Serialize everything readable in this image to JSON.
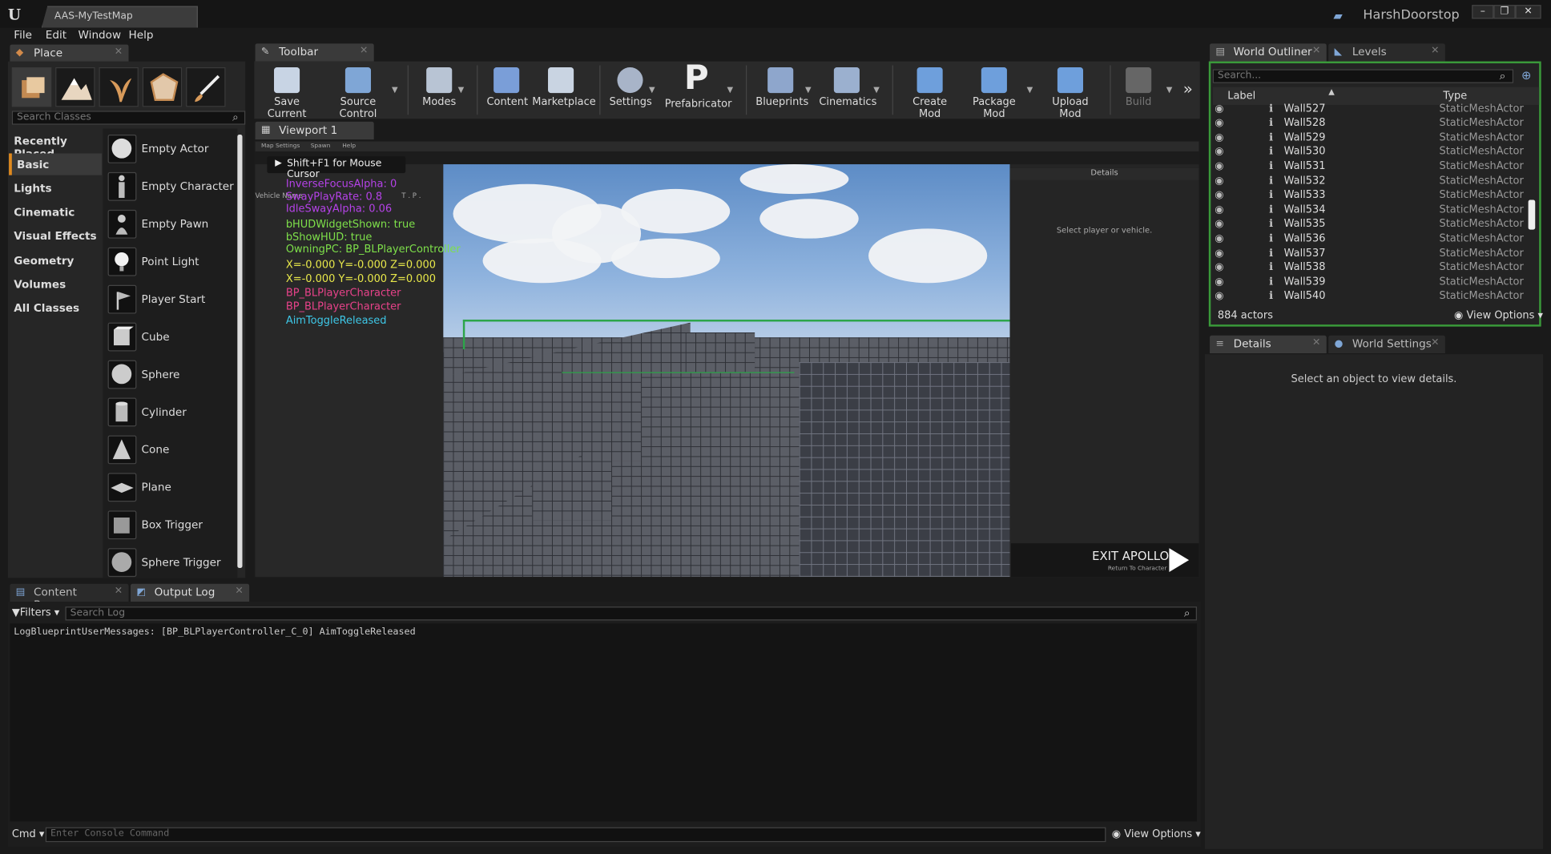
{
  "window": {
    "tab_title": "AAS-MyTestMap",
    "user": "HarshDoorstop"
  },
  "menu": [
    "File",
    "Edit",
    "Window",
    "Help"
  ],
  "place": {
    "tab": "Place",
    "search_placeholder": "Search Classes",
    "categories": [
      "Recently Placed",
      "Basic",
      "Lights",
      "Cinematic",
      "Visual Effects",
      "Geometry",
      "Volumes",
      "All Classes"
    ],
    "items": [
      "Empty Actor",
      "Empty Character",
      "Empty Pawn",
      "Point Light",
      "Player Start",
      "Cube",
      "Sphere",
      "Cylinder",
      "Cone",
      "Plane",
      "Box Trigger",
      "Sphere Trigger"
    ]
  },
  "toolbar": {
    "tab": "Toolbar",
    "buttons": [
      "Save Current",
      "Source Control",
      "Modes",
      "Content",
      "Marketplace",
      "Settings",
      "Prefabricator",
      "Blueprints",
      "Cinematics",
      "Create Mod",
      "Package Mod",
      "Upload Mod",
      "Build"
    ]
  },
  "viewport": {
    "tab": "Viewport 1",
    "menu": [
      "Map Settings",
      "Spawn",
      "Help"
    ],
    "mouse_hint": "Shift+F1 for Mouse Cursor",
    "vehicle_label": "Vehicle Name",
    "vehicle_cols": "T . P .",
    "details_title": "Details",
    "details_msg": "Select player or vehicle.",
    "exit_title": "EXIT APOLLO",
    "exit_sub": "Return To Character",
    "debug_lines": [
      {
        "text": "InverseFocusAlpha: 0",
        "color": "#b542e8"
      },
      {
        "text": "SwayPlayRate: 0.8",
        "color": "#b542e8"
      },
      {
        "text": "IdleSwayAlpha: 0.06",
        "color": "#b542e8"
      },
      {
        "text": "bHUDWidgetShown: true",
        "color": "#7ee04a"
      },
      {
        "text": "bShowHUD: true",
        "color": "#7ee04a"
      },
      {
        "text": "OwningPC: BP_BLPlayerController",
        "color": "#7ee04a"
      },
      {
        "text": "X=-0.000 Y=-0.000 Z=0.000",
        "color": "#e8e84a"
      },
      {
        "text": "X=-0.000 Y=-0.000 Z=0.000",
        "color": "#e8e84a"
      },
      {
        "text": "BP_BLPlayerCharacter",
        "color": "#e8428a"
      },
      {
        "text": "BP_BLPlayerCharacter",
        "color": "#e8428a"
      },
      {
        "text": "AimToggleReleased",
        "color": "#3ec8e8"
      }
    ]
  },
  "outliner": {
    "tab_outliner": "World Outliner",
    "tab_levels": "Levels",
    "search_placeholder": "Search...",
    "col_label": "Label",
    "col_type": "Type",
    "rows": [
      {
        "label": "Wall527",
        "type": "StaticMeshActor"
      },
      {
        "label": "Wall528",
        "type": "StaticMeshActor"
      },
      {
        "label": "Wall529",
        "type": "StaticMeshActor"
      },
      {
        "label": "Wall530",
        "type": "StaticMeshActor"
      },
      {
        "label": "Wall531",
        "type": "StaticMeshActor"
      },
      {
        "label": "Wall532",
        "type": "StaticMeshActor"
      },
      {
        "label": "Wall533",
        "type": "StaticMeshActor"
      },
      {
        "label": "Wall534",
        "type": "StaticMeshActor"
      },
      {
        "label": "Wall535",
        "type": "StaticMeshActor"
      },
      {
        "label": "Wall536",
        "type": "StaticMeshActor"
      },
      {
        "label": "Wall537",
        "type": "StaticMeshActor"
      },
      {
        "label": "Wall538",
        "type": "StaticMeshActor"
      },
      {
        "label": "Wall539",
        "type": "StaticMeshActor"
      },
      {
        "label": "Wall540",
        "type": "StaticMeshActor"
      }
    ],
    "actor_count": "884 actors",
    "view_options": "View Options"
  },
  "details": {
    "tab": "Details",
    "tab_world": "World Settings",
    "message": "Select an object to view details."
  },
  "bottom": {
    "tab_content": "Content Browser",
    "tab_log": "Output Log",
    "filters": "Filters",
    "search_placeholder": "Search Log",
    "log_line": "LogBlueprintUserMessages: [BP_BLPlayerController_C_0] AimToggleReleased",
    "cmd_label": "Cmd",
    "console_placeholder": "Enter Console Command",
    "view_options": "View Options"
  },
  "colors": {
    "accent": "#e08a1e",
    "selection": "#3a9a3a",
    "panel": "#232323"
  }
}
